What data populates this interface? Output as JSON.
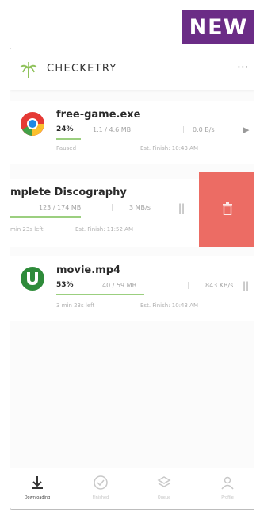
{
  "badge": "NEW",
  "header": {
    "title": "CHECKETRY",
    "more": "⋯"
  },
  "downloads": [
    {
      "name": "free-game.exe",
      "percent": "24%",
      "size": "1.1 / 4.6 MB",
      "speed": "0.0 B/s",
      "status": "Paused",
      "eta": "Est. Finish: 10:43 AM",
      "progress": 0.24,
      "control": "▶",
      "icon": "chrome-icon"
    },
    {
      "name": "mplete Discography",
      "percent": "",
      "size": "123 / 174 MB",
      "speed": "3 MB/s",
      "status": "min 23s left",
      "eta": "Est. Finish: 11:52 AM",
      "progress": 0.71,
      "control": "||",
      "icon": "torrent-icon"
    },
    {
      "name": "movie.mp4",
      "percent": "53%",
      "size": "40 / 59 MB",
      "speed": "843 KB/s",
      "status": "3 min 23s left",
      "eta": "Est. Finish: 10:43 AM",
      "progress": 0.53,
      "control": "||",
      "icon": "utorrent-icon"
    }
  ],
  "delete_icon": "trash-icon",
  "nav": [
    {
      "label": "Downloading",
      "icon": "download-icon",
      "active": true
    },
    {
      "label": "Finished",
      "icon": "check-circle-icon",
      "active": false
    },
    {
      "label": "Queue",
      "icon": "stack-icon",
      "active": false
    },
    {
      "label": "Profile",
      "icon": "user-icon",
      "active": false
    }
  ],
  "colors": {
    "badge": "#6b2c86",
    "delete": "#ec6c64",
    "progress": "#9bcf7f",
    "logo": "#8fc25b"
  }
}
